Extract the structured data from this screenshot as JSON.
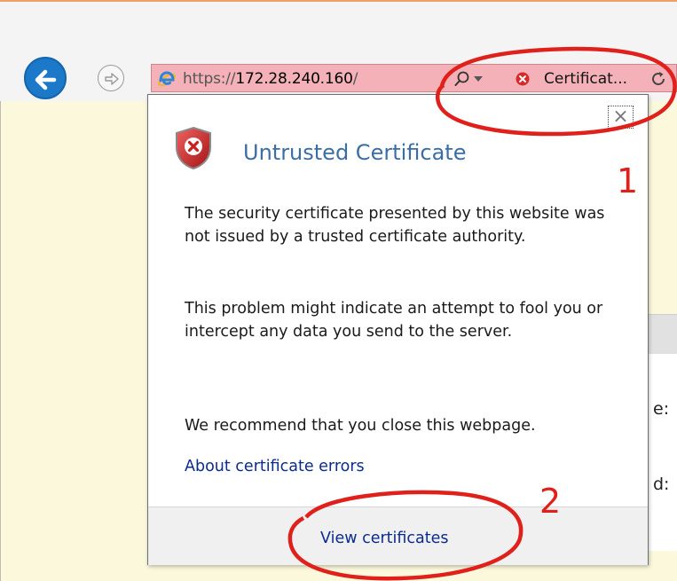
{
  "browser": {
    "address_bar": {
      "url_scheme": "https://",
      "url_host": "172.28.240.160",
      "url_path": "/",
      "certificate_label": "Certificat...",
      "background_color": "#f4b2b8"
    },
    "icons": {
      "back": "back-arrow-icon",
      "forward": "forward-arrow-icon",
      "site": "ie-logo-icon",
      "search": "search-icon",
      "dropdown": "chevron-down-icon",
      "cert_error": "cert-error-icon",
      "refresh": "refresh-icon"
    }
  },
  "background_page": {
    "partial_text_1": "e:",
    "partial_text_2": "d:",
    "background_color": "#fbf8dc"
  },
  "flyout": {
    "close_glyph": "×",
    "title": "Untrusted Certificate",
    "messages": [
      "The security certificate presented by this website was not issued by a trusted certificate authority.",
      "This problem might indicate an attempt to fool you or intercept any data you send to the server.",
      "We recommend that you close this webpage."
    ],
    "about_link": "About certificate errors",
    "view_certificates": "View certificates",
    "title_color": "#3a6ea5",
    "link_color": "#0b2c8f"
  },
  "annotations": {
    "label_1": "1",
    "label_2": "2",
    "color": "#e0201b"
  }
}
